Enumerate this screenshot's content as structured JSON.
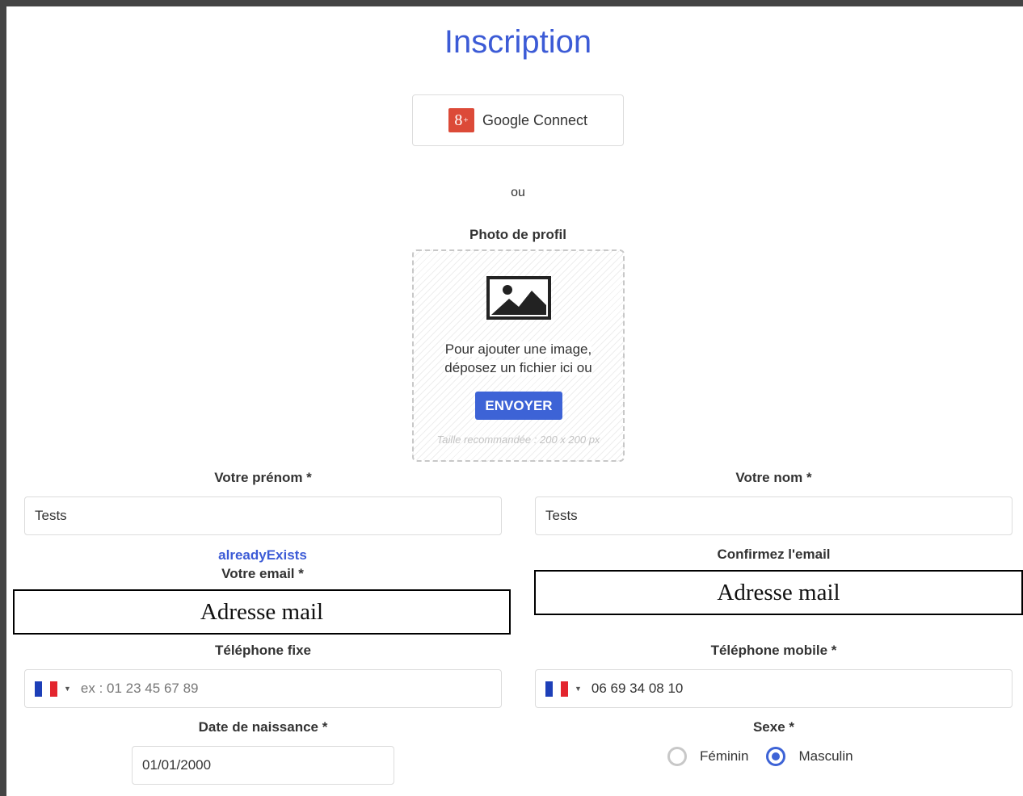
{
  "title": "Inscription",
  "google": {
    "icon_text": "8",
    "icon_plus": "+",
    "label": "Google Connect"
  },
  "separator": "ou",
  "photo": {
    "label": "Photo de profil",
    "text_line1": "Pour ajouter une image,",
    "text_line2": "déposez un fichier ici ou",
    "button": "ENVOYER",
    "hint": "Taille recommandée : 200 x 200 px"
  },
  "fields": {
    "prenom": {
      "label": "Votre prénom *",
      "value": "Tests"
    },
    "nom": {
      "label": "Votre nom *",
      "value": "Tests"
    },
    "email": {
      "error": "alreadyExists",
      "label": "Votre email *",
      "value": "Adresse mail"
    },
    "confirm_email": {
      "label": "Confirmez l'email",
      "value": "Adresse mail"
    },
    "tel_fixe": {
      "label": "Téléphone fixe",
      "placeholder": "ex : 01 23 45 67 89",
      "country": "france-flag-icon"
    },
    "tel_mobile": {
      "label": "Téléphone mobile *",
      "value": "06 69 34 08 10",
      "country": "france-flag-icon"
    },
    "naissance": {
      "label": "Date de naissance *",
      "value": "01/01/2000"
    },
    "sexe": {
      "label": "Sexe *",
      "options": [
        {
          "label": "Féminin",
          "selected": false
        },
        {
          "label": "Masculin",
          "selected": true
        }
      ]
    }
  },
  "colors": {
    "accent": "#3c5bd6",
    "google": "#dc4a38",
    "flag_blue": "#1d3fb8",
    "flag_red": "#e3252e"
  }
}
